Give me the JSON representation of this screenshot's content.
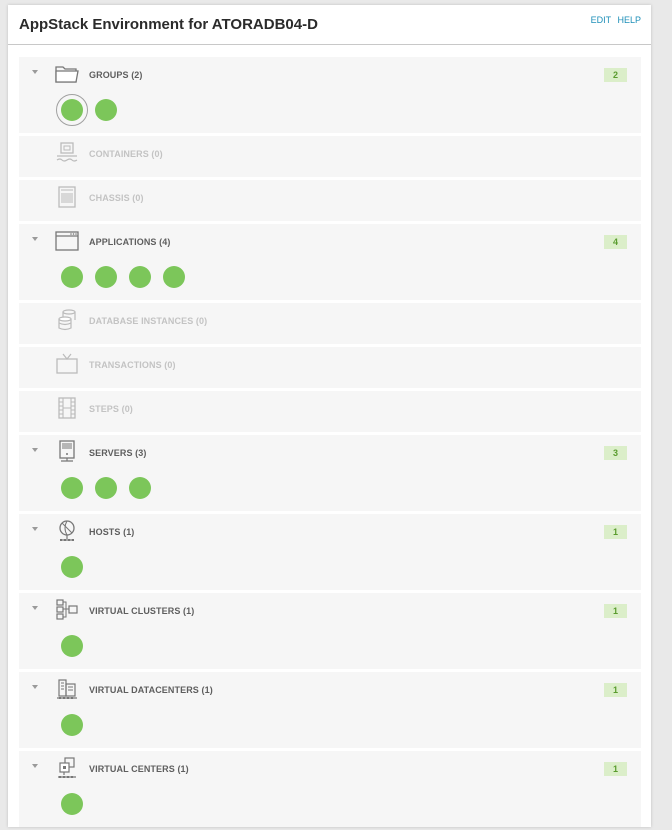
{
  "header": {
    "title": "AppStack Environment for ATORADB04-D",
    "edit_label": "EDIT",
    "help_label": "HELP"
  },
  "colors": {
    "status_ok": "#7cc65a",
    "badge_bg": "#dbeec9",
    "badge_text": "#5a9c2e",
    "link": "#1e8fb8"
  },
  "sections": [
    {
      "id": "groups",
      "label": "GROUPS (2)",
      "icon": "folder-icon",
      "count": "2",
      "items": 2,
      "expanded": true
    },
    {
      "id": "containers",
      "label": "CONTAINERS (0)",
      "icon": "container-icon",
      "count": "",
      "items": 0,
      "expanded": false
    },
    {
      "id": "chassis",
      "label": "CHASSIS (0)",
      "icon": "chassis-icon",
      "count": "",
      "items": 0,
      "expanded": false
    },
    {
      "id": "applications",
      "label": "APPLICATIONS (4)",
      "icon": "application-window-icon",
      "count": "4",
      "items": 4,
      "expanded": true
    },
    {
      "id": "database-instances",
      "label": "DATABASE INSTANCES (0)",
      "icon": "database-icon",
      "count": "",
      "items": 0,
      "expanded": false
    },
    {
      "id": "transactions",
      "label": "TRANSACTIONS (0)",
      "icon": "monitor-icon",
      "count": "",
      "items": 0,
      "expanded": false
    },
    {
      "id": "steps",
      "label": "STEPS (0)",
      "icon": "film-strip-icon",
      "count": "",
      "items": 0,
      "expanded": false
    },
    {
      "id": "servers",
      "label": "SERVERS (3)",
      "icon": "server-icon",
      "count": "3",
      "items": 3,
      "expanded": true
    },
    {
      "id": "hosts",
      "label": "HOSTS (1)",
      "icon": "host-icon",
      "count": "1",
      "items": 1,
      "expanded": true
    },
    {
      "id": "virtual-clusters",
      "label": "VIRTUAL CLUSTERS (1)",
      "icon": "cluster-icon",
      "count": "1",
      "items": 1,
      "expanded": true
    },
    {
      "id": "virtual-datacenters",
      "label": "VIRTUAL DATACENTERS (1)",
      "icon": "datacenter-icon",
      "count": "1",
      "items": 1,
      "expanded": true
    },
    {
      "id": "virtual-centers",
      "label": "VIRTUAL CENTERS (1)",
      "icon": "virtual-center-icon",
      "count": "1",
      "items": 1,
      "expanded": true
    }
  ]
}
